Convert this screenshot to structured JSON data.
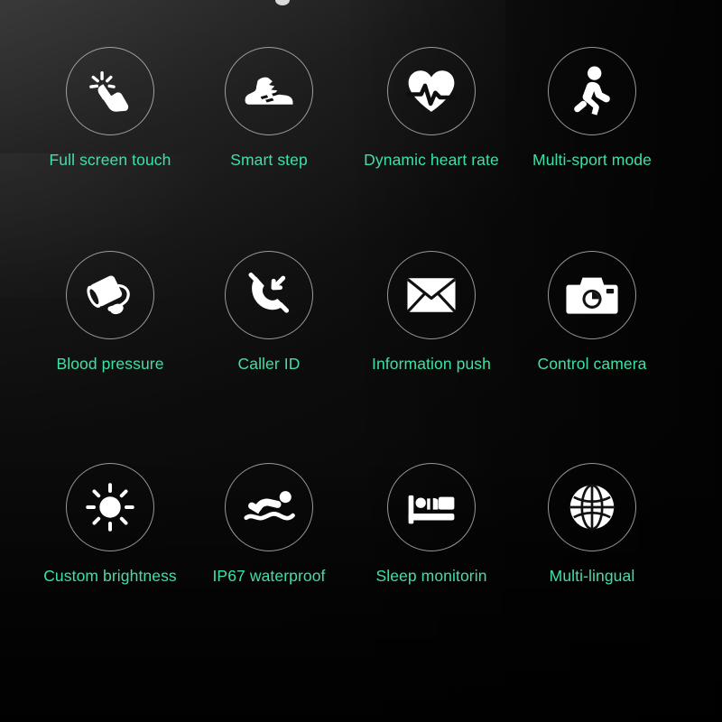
{
  "board": {
    "background_color": "#0d0d0d",
    "accent_color": "#3fe0a5",
    "ring_color": "#d0d0d0",
    "icon_color": "#ffffff",
    "columns": 4,
    "rows": 3
  },
  "features": [
    {
      "id": "full-screen-touch",
      "label": "Full screen touch",
      "icon": "touch-gesture-icon",
      "row": 1,
      "column": 1
    },
    {
      "id": "smart-step",
      "label": "Smart step",
      "icon": "running-shoe-icon",
      "row": 1,
      "column": 2
    },
    {
      "id": "dynamic-heart-rate",
      "label": "Dynamic heart rate",
      "icon": "heart-pulse-icon",
      "row": 1,
      "column": 3
    },
    {
      "id": "multi-sport-mode",
      "label": "Multi-sport mode",
      "icon": "running-person-icon",
      "row": 1,
      "column": 4
    },
    {
      "id": "blood-pressure",
      "label": "Blood pressure",
      "icon": "blood-pressure-cuff-icon",
      "row": 2,
      "column": 1
    },
    {
      "id": "caller-id",
      "label": "Caller ID",
      "icon": "incoming-call-icon",
      "row": 2,
      "column": 2
    },
    {
      "id": "information-push",
      "label": "Information push",
      "icon": "envelope-icon",
      "row": 2,
      "column": 3
    },
    {
      "id": "control-camera",
      "label": "Control camera",
      "icon": "camera-icon",
      "row": 2,
      "column": 4
    },
    {
      "id": "custom-brightness",
      "label": "Custom brightness",
      "icon": "sun-brightness-icon",
      "row": 3,
      "column": 1
    },
    {
      "id": "ip67-waterproof",
      "label": "IP67 waterproof",
      "icon": "swimmer-icon",
      "row": 3,
      "column": 2
    },
    {
      "id": "sleep-monitoring",
      "label": "Sleep monitorin",
      "icon": "person-in-bed-icon",
      "row": 3,
      "column": 3
    },
    {
      "id": "multi-lingual",
      "label": "Multi-lingual",
      "icon": "globe-icon",
      "row": 3,
      "column": 4
    }
  ]
}
